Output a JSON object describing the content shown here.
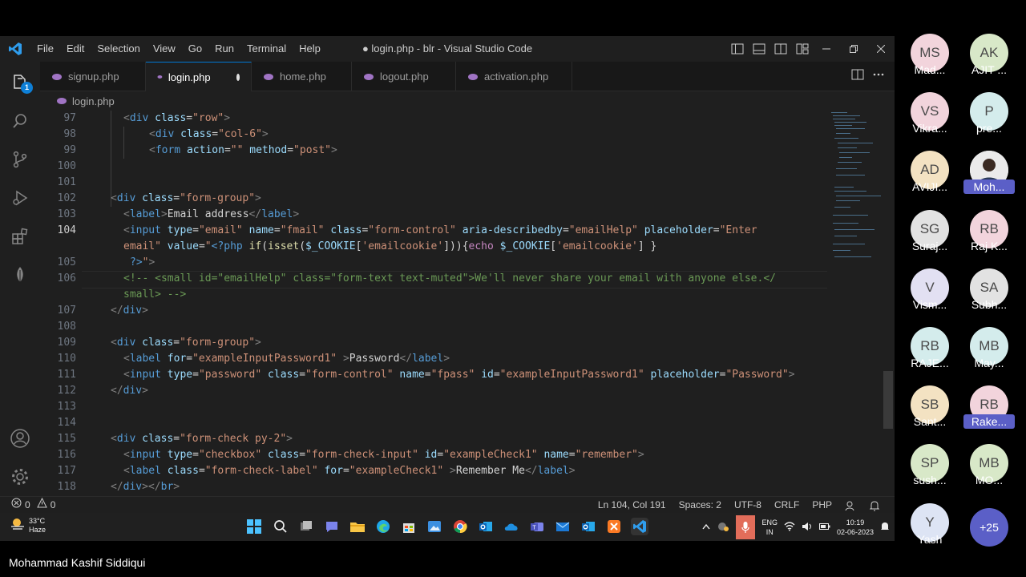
{
  "window": {
    "title": "● login.php - blr - Visual Studio Code",
    "menu": [
      "File",
      "Edit",
      "Selection",
      "View",
      "Go",
      "Run",
      "Terminal",
      "Help"
    ]
  },
  "activity_badge": "1",
  "tabs": [
    {
      "label": "signup.php",
      "active": false
    },
    {
      "label": "login.php",
      "active": true,
      "dirty": true
    },
    {
      "label": "home.php",
      "active": false
    },
    {
      "label": "logout.php",
      "active": false
    },
    {
      "label": "activation.php",
      "active": false
    }
  ],
  "breadcrumb": "login.php",
  "editor": {
    "lines": [
      {
        "num": "97"
      },
      {
        "num": "98"
      },
      {
        "num": "99"
      },
      {
        "num": "100"
      },
      {
        "num": "101"
      },
      {
        "num": "102"
      },
      {
        "num": "103"
      },
      {
        "num": "104"
      },
      {
        "num": "105"
      },
      {
        "num": "106"
      },
      {
        "num": "107"
      },
      {
        "num": "108"
      },
      {
        "num": "109"
      },
      {
        "num": "110"
      },
      {
        "num": "111"
      },
      {
        "num": "112"
      },
      {
        "num": "113"
      },
      {
        "num": "114"
      },
      {
        "num": "115"
      },
      {
        "num": "116"
      },
      {
        "num": "117"
      },
      {
        "num": "118"
      }
    ]
  },
  "status": {
    "errors": "0",
    "warnings": "0",
    "position": "Ln 104, Col 191",
    "spaces": "Spaces: 2",
    "encoding": "UTF-8",
    "eol": "CRLF",
    "language": "PHP"
  },
  "taskbar": {
    "temperature": "33°C",
    "weather": "Haze",
    "lang_top": "ENG",
    "lang_bottom": "IN",
    "time": "10:19",
    "date": "02-06-2023"
  },
  "participants": [
    {
      "initials": "MS",
      "name": "Mad...",
      "color": "#f2d4dc"
    },
    {
      "initials": "AK",
      "name": "AJIT ...",
      "color": "#d8e8c8"
    },
    {
      "initials": "VS",
      "name": "Vikra...",
      "color": "#f2d4dc"
    },
    {
      "initials": "P",
      "name": "pre...",
      "color": "#d4ecec"
    },
    {
      "initials": "AD",
      "name": "AVIJI...",
      "color": "#f3e2c2"
    },
    {
      "initials": "",
      "name": "Moh...",
      "color": "#ffffff",
      "photo": true,
      "highlight": true
    },
    {
      "initials": "SG",
      "name": "Suraj...",
      "color": "#e2e2e2"
    },
    {
      "initials": "RB",
      "name": "Raj K...",
      "color": "#f2d4dc"
    },
    {
      "initials": "V",
      "name": "Vism...",
      "color": "#e2e0f2"
    },
    {
      "initials": "SA",
      "name": "Subh...",
      "color": "#e2e2e2"
    },
    {
      "initials": "RB",
      "name": "RAJE...",
      "color": "#d4ecec"
    },
    {
      "initials": "MB",
      "name": "May...",
      "color": "#d4ecec"
    },
    {
      "initials": "SB",
      "name": "Sant...",
      "color": "#f3e2c2"
    },
    {
      "initials": "RB",
      "name": "Rake...",
      "color": "#f2d4dc",
      "highlight": true
    },
    {
      "initials": "SP",
      "name": "sush...",
      "color": "#d8e8c8"
    },
    {
      "initials": "MB",
      "name": "MO...",
      "color": "#d8e8c8"
    },
    {
      "initials": "Y",
      "name": "Yash",
      "color": "#dde4f4"
    },
    {
      "initials": "+25",
      "name": "",
      "color": "#5b5fc7",
      "more": true
    }
  ],
  "presenter_name": "Mohammad Kashif Siddiqui"
}
